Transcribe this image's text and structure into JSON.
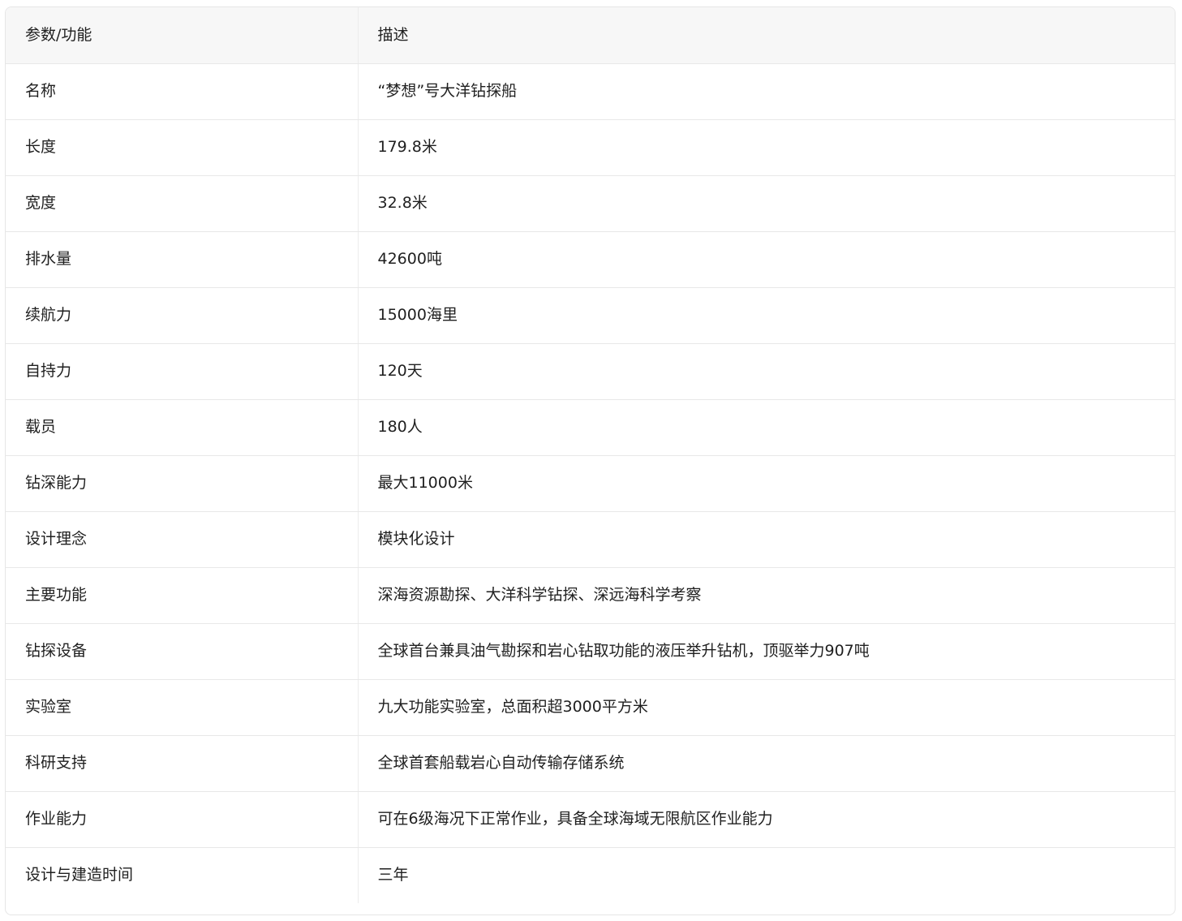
{
  "table": {
    "headers": [
      "参数/功能",
      "描述"
    ],
    "rows": [
      [
        "名称",
        "“梦想”号大洋钻探船"
      ],
      [
        "长度",
        "179.8米"
      ],
      [
        "宽度",
        "32.8米"
      ],
      [
        "排水量",
        "42600吨"
      ],
      [
        "续航力",
        "15000海里"
      ],
      [
        "自持力",
        "120天"
      ],
      [
        "载员",
        "180人"
      ],
      [
        "钻深能力",
        "最大11000米"
      ],
      [
        "设计理念",
        "模块化设计"
      ],
      [
        "主要功能",
        "深海资源勘探、大洋科学钻探、深远海科学考察"
      ],
      [
        "钻探设备",
        "全球首台兼具油气勘探和岩心钻取功能的液压举升钻机，顶驱举力907吨"
      ],
      [
        "实验室",
        "九大功能实验室，总面积超3000平方米"
      ],
      [
        "科研支持",
        "全球首套船载岩心自动传输存储系统"
      ],
      [
        "作业能力",
        "可在6级海况下正常作业，具备全球海域无限航区作业能力"
      ],
      [
        "设计与建造时间",
        "三年"
      ]
    ]
  }
}
